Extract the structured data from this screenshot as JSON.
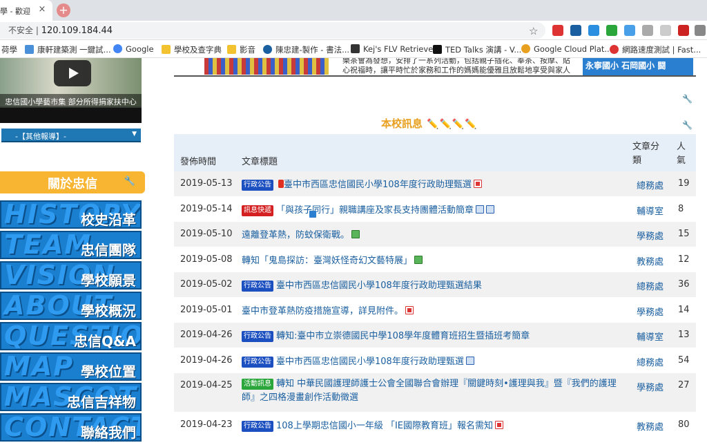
{
  "browser": {
    "tab_title": "學 - 歡迎",
    "tab_close": "×",
    "new_tab": "+",
    "security": "不安全",
    "url": "120.109.184.44",
    "star": "☆"
  },
  "bookmarks": [
    {
      "label": "荷學",
      "color": "#888"
    },
    {
      "label": "康軒建築測 一鍵試...",
      "color": "#4a90d9"
    },
    {
      "label": "Google",
      "color": "#4285f4"
    },
    {
      "label": "學校及查字典",
      "color": "#f2c230"
    },
    {
      "label": "影音",
      "color": "#f2c230"
    },
    {
      "label": "陳忠建-製作 - 書法...",
      "color": "#1a5fa0"
    },
    {
      "label": "Kej's FLV Retriever",
      "color": "#333"
    },
    {
      "label": "TED Talks 演講 - V...",
      "color": "#111"
    },
    {
      "label": "Google Cloud Plat...",
      "color": "#e8a020"
    },
    {
      "label": "網路速度測試 | Fast...",
      "color": "#d33"
    }
  ],
  "video": {
    "caption": "忠信國小學藝市集 部分所得捐家扶中心"
  },
  "other_news": {
    "label": "-【其他報導】-",
    "arrow": "▼"
  },
  "about": {
    "title": "關於忠信",
    "wrench": "🔧"
  },
  "menu": [
    {
      "bg": "HISTORY",
      "label": "校史沿革"
    },
    {
      "bg": "TEAM",
      "label": "忠信團隊"
    },
    {
      "bg": "VISION",
      "label": "學校願景"
    },
    {
      "bg": "ABOUT",
      "label": "學校概況"
    },
    {
      "bg": "QUESTION",
      "label": "忠信Q&A"
    },
    {
      "bg": "MAP",
      "label": "學校位置"
    },
    {
      "bg": "MASCOT",
      "label": "忠信吉祥物"
    },
    {
      "bg": "CONTACT",
      "label": "聯絡我們"
    }
  ],
  "top_strip": {
    "text": "樂茶會為發想，安排了一系列活動，包括親子插花、奉茶、按摩、貼心祝福時，讓平時忙於家務和工作的媽媽能優雅且放鬆地享受與家人相處",
    "right": "永寧國小 石岡國小 闘"
  },
  "section": {
    "title": "本校訊息",
    "pencils": "✏️✏️✏️✏️"
  },
  "table": {
    "headers": {
      "date": "發佈時間",
      "title": "文章標題",
      "category": "文章分類",
      "views": "人氣"
    },
    "rows": [
      {
        "date": "2019-05-13",
        "tag": "行政公告",
        "tag_type": "admin",
        "pre": "warn",
        "title": "臺中市西區忠信國民小學108年度行政助理甄選",
        "icons": [
          "pdf"
        ],
        "category": "總務處",
        "views": "19"
      },
      {
        "date": "2019-05-14",
        "tag": "訊息快遞",
        "tag_type": "fast",
        "pre": "t",
        "title": "「與孩子同行」親職講座及家長支持團體活動簡章",
        "icons": [
          "doc",
          "doc"
        ],
        "category": "輔導室",
        "views": "8"
      },
      {
        "date": "2019-05-10",
        "tag": "",
        "tag_type": "",
        "pre": "",
        "title": "遠離登革熱，防蚊保衛戰。",
        "icons": [
          "img"
        ],
        "category": "學務處",
        "views": "15"
      },
      {
        "date": "2019-05-08",
        "tag": "",
        "tag_type": "",
        "pre": "",
        "title": "轉知「鬼島探訪：臺灣妖怪奇幻文藝特展」",
        "icons": [
          "img"
        ],
        "category": "教務處",
        "views": "12"
      },
      {
        "date": "2019-05-02",
        "tag": "行政公告",
        "tag_type": "admin",
        "pre": "",
        "title": "臺中市西區忠信國民小學108年度行政助理甄選結果",
        "icons": [],
        "category": "總務處",
        "views": "36"
      },
      {
        "date": "2019-05-01",
        "tag": "",
        "tag_type": "",
        "pre": "",
        "title": "臺中市登革熱防疫措施宣導，詳見附件。",
        "icons": [
          "pdf"
        ],
        "category": "學務處",
        "views": "14"
      },
      {
        "date": "2019-04-26",
        "tag": "行政公告",
        "tag_type": "admin",
        "pre": "",
        "title": "轉知:臺中市立崇德國民中學108學年度體育班招生暨插班考簡章",
        "icons": [],
        "category": "輔導室",
        "views": "13"
      },
      {
        "date": "2019-04-26",
        "tag": "行政公告",
        "tag_type": "admin",
        "pre": "",
        "title": "臺中市西區忠信國民小學108年度行政助理甄選",
        "icons": [
          "doc"
        ],
        "category": "總務處",
        "views": "54"
      },
      {
        "date": "2019-04-25",
        "tag": "活動訊息",
        "tag_type": "act",
        "pre": "",
        "title": "轉知 中華民國護理師護士公會全國聯合會辦理『關鍵時刻•護理與我』暨『我們的護理師』之四格漫畫創作活動徵選",
        "icons": [],
        "category": "學務處",
        "views": "27"
      },
      {
        "date": "2019-04-23",
        "tag": "行政公告",
        "tag_type": "admin",
        "pre": "",
        "title": "108上學期忠信國小一年級 「IE國際教育班」報名需知",
        "icons": [
          "pdf"
        ],
        "category": "教務處",
        "views": "80"
      }
    ]
  }
}
